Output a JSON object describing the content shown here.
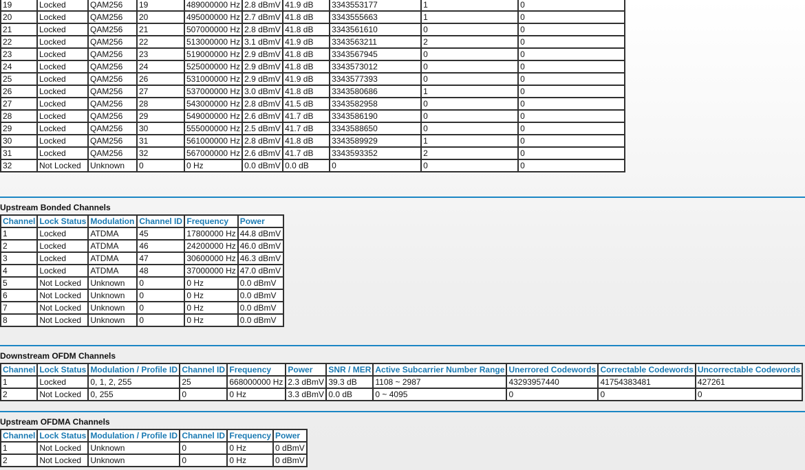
{
  "downstream_bonded": {
    "rows": [
      [
        "19",
        "Locked",
        "QAM256",
        "19",
        "489000000 Hz",
        "2.8 dBmV",
        "41.9 dB",
        "3343553177",
        "1",
        "0"
      ],
      [
        "20",
        "Locked",
        "QAM256",
        "20",
        "495000000 Hz",
        "2.7 dBmV",
        "41.8 dB",
        "3343555663",
        "1",
        "0"
      ],
      [
        "21",
        "Locked",
        "QAM256",
        "21",
        "507000000 Hz",
        "2.8 dBmV",
        "41.8 dB",
        "3343561610",
        "0",
        "0"
      ],
      [
        "22",
        "Locked",
        "QAM256",
        "22",
        "513000000 Hz",
        "3.1 dBmV",
        "41.9 dB",
        "3343563211",
        "2",
        "0"
      ],
      [
        "23",
        "Locked",
        "QAM256",
        "23",
        "519000000 Hz",
        "2.9 dBmV",
        "41.8 dB",
        "3343567945",
        "0",
        "0"
      ],
      [
        "24",
        "Locked",
        "QAM256",
        "24",
        "525000000 Hz",
        "2.9 dBmV",
        "41.8 dB",
        "3343573012",
        "0",
        "0"
      ],
      [
        "25",
        "Locked",
        "QAM256",
        "26",
        "531000000 Hz",
        "2.9 dBmV",
        "41.9 dB",
        "3343577393",
        "0",
        "0"
      ],
      [
        "26",
        "Locked",
        "QAM256",
        "27",
        "537000000 Hz",
        "3.0 dBmV",
        "41.8 dB",
        "3343580686",
        "1",
        "0"
      ],
      [
        "27",
        "Locked",
        "QAM256",
        "28",
        "543000000 Hz",
        "2.8 dBmV",
        "41.5 dB",
        "3343582958",
        "0",
        "0"
      ],
      [
        "28",
        "Locked",
        "QAM256",
        "29",
        "549000000 Hz",
        "2.6 dBmV",
        "41.7 dB",
        "3343586190",
        "0",
        "0"
      ],
      [
        "29",
        "Locked",
        "QAM256",
        "30",
        "555000000 Hz",
        "2.5 dBmV",
        "41.7 dB",
        "3343588650",
        "0",
        "0"
      ],
      [
        "30",
        "Locked",
        "QAM256",
        "31",
        "561000000 Hz",
        "2.8 dBmV",
        "41.8 dB",
        "3343589929",
        "1",
        "0"
      ],
      [
        "31",
        "Locked",
        "QAM256",
        "32",
        "567000000 Hz",
        "2.6 dBmV",
        "41.7 dB",
        "3343593352",
        "2",
        "0"
      ],
      [
        "32",
        "Not Locked",
        "Unknown",
        "0",
        "0 Hz",
        "0.0 dBmV",
        "0.0 dB",
        "0",
        "0",
        "0"
      ]
    ]
  },
  "upstream_bonded": {
    "title": "Upstream Bonded Channels",
    "headers": [
      "Channel",
      "Lock Status",
      "Modulation",
      "Channel ID",
      "Frequency",
      "Power"
    ],
    "rows": [
      [
        "1",
        "Locked",
        "ATDMA",
        "45",
        "17800000 Hz",
        "44.8 dBmV"
      ],
      [
        "2",
        "Locked",
        "ATDMA",
        "46",
        "24200000 Hz",
        "46.0 dBmV"
      ],
      [
        "3",
        "Locked",
        "ATDMA",
        "47",
        "30600000 Hz",
        "46.3 dBmV"
      ],
      [
        "4",
        "Locked",
        "ATDMA",
        "48",
        "37000000 Hz",
        "47.0 dBmV"
      ],
      [
        "5",
        "Not Locked",
        "Unknown",
        "0",
        "0 Hz",
        "0.0 dBmV"
      ],
      [
        "6",
        "Not Locked",
        "Unknown",
        "0",
        "0 Hz",
        "0.0 dBmV"
      ],
      [
        "7",
        "Not Locked",
        "Unknown",
        "0",
        "0 Hz",
        "0.0 dBmV"
      ],
      [
        "8",
        "Not Locked",
        "Unknown",
        "0",
        "0 Hz",
        "0.0 dBmV"
      ]
    ]
  },
  "downstream_ofdm": {
    "title": "Downstream OFDM Channels",
    "headers": [
      "Channel",
      "Lock Status",
      "Modulation / Profile ID",
      "Channel ID",
      "Frequency",
      "Power",
      "SNR / MER",
      "Active Subcarrier Number Range",
      "Unerrored Codewords",
      "Correctable Codewords",
      "Uncorrectable Codewords"
    ],
    "rows": [
      [
        "1",
        "Locked",
        "0, 1, 2, 255",
        "25",
        "668000000 Hz",
        "2.3 dBmV",
        "39.3 dB",
        "1108 ~ 2987",
        "43293957440",
        "41754383481",
        "427261"
      ],
      [
        "2",
        "Not Locked",
        "0, 255",
        "0",
        "0 Hz",
        "3.3 dBmV",
        "0.0 dB",
        "0 ~ 4095",
        "0",
        "0",
        "0"
      ]
    ]
  },
  "upstream_ofdma": {
    "title": "Upstream OFDMA Channels",
    "headers": [
      "Channel",
      "Lock Status",
      "Modulation / Profile ID",
      "Channel ID",
      "Frequency",
      "Power"
    ],
    "rows": [
      [
        "1",
        "Not Locked",
        "Unknown",
        "0",
        "0 Hz",
        "0 dBmV"
      ],
      [
        "2",
        "Not Locked",
        "Unknown",
        "0",
        "0 Hz",
        "0 dBmV"
      ]
    ]
  },
  "colors": {
    "header_text": "#1a7ab3",
    "divider": "#1b86c4",
    "border": "#303030"
  }
}
